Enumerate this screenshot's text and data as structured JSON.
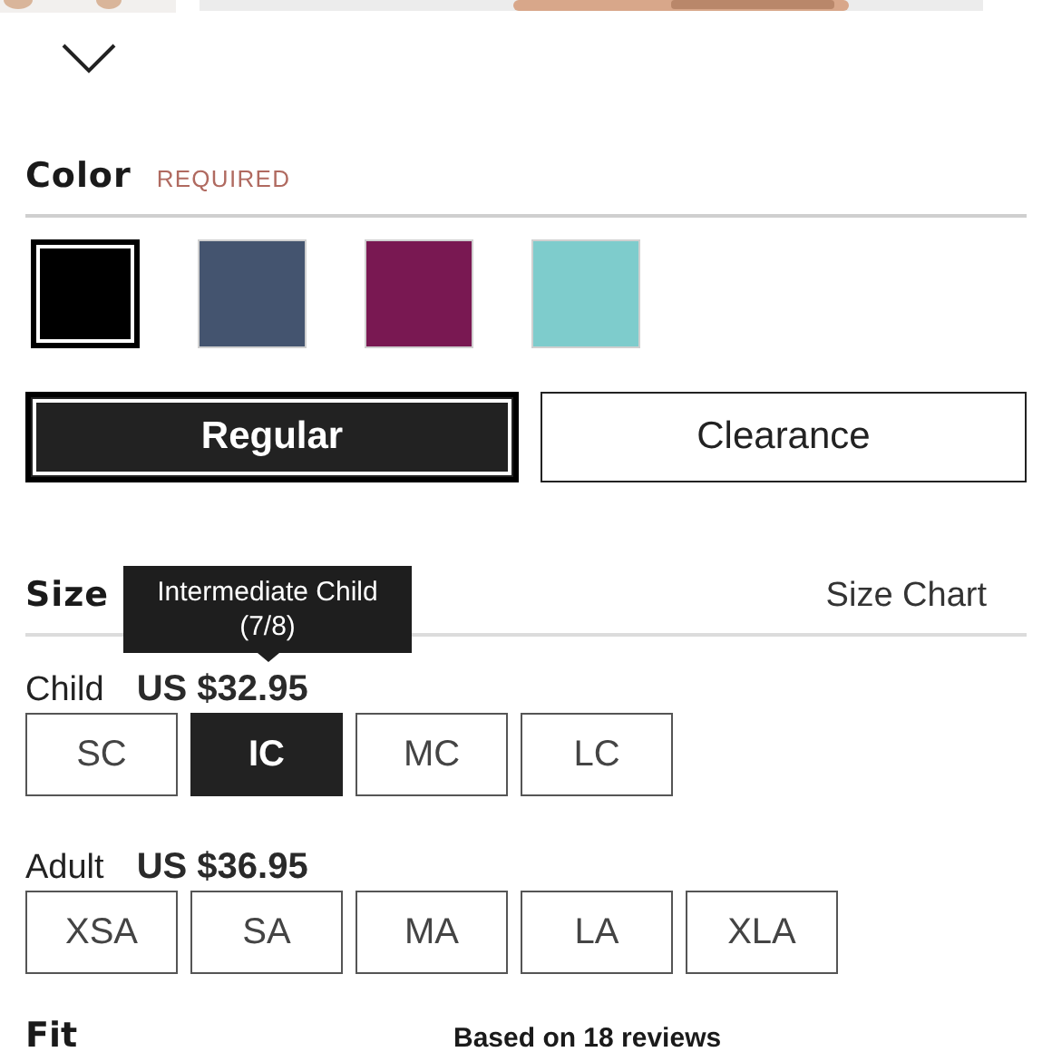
{
  "color": {
    "title": "Color",
    "required_label": "REQUIRED",
    "swatches": [
      {
        "color": "#000000",
        "selected": true
      },
      {
        "color": "#44546f",
        "selected": false
      },
      {
        "color": "#791852",
        "selected": false
      },
      {
        "color": "#7ecccc",
        "selected": false
      }
    ]
  },
  "price_types": [
    {
      "label": "Regular",
      "selected": true
    },
    {
      "label": "Clearance",
      "selected": false
    }
  ],
  "size": {
    "title": "Size",
    "chart_link": "Size Chart",
    "groups": [
      {
        "label": "Child",
        "price": "US $32.95",
        "sizes": [
          {
            "label": "SC",
            "selected": false
          },
          {
            "label": "IC",
            "selected": true
          },
          {
            "label": "MC",
            "selected": false
          },
          {
            "label": "LC",
            "selected": false
          }
        ]
      },
      {
        "label": "Adult",
        "price": "US $36.95",
        "sizes": [
          {
            "label": "XSA",
            "selected": false
          },
          {
            "label": "SA",
            "selected": false
          },
          {
            "label": "MA",
            "selected": false
          },
          {
            "label": "LA",
            "selected": false
          },
          {
            "label": "XLA",
            "selected": false
          }
        ]
      }
    ],
    "tooltip": {
      "title": "Intermediate Child",
      "subtitle": "(7/8)"
    }
  },
  "fit": {
    "title": "Fit",
    "reviews": "Based on 18 reviews"
  }
}
